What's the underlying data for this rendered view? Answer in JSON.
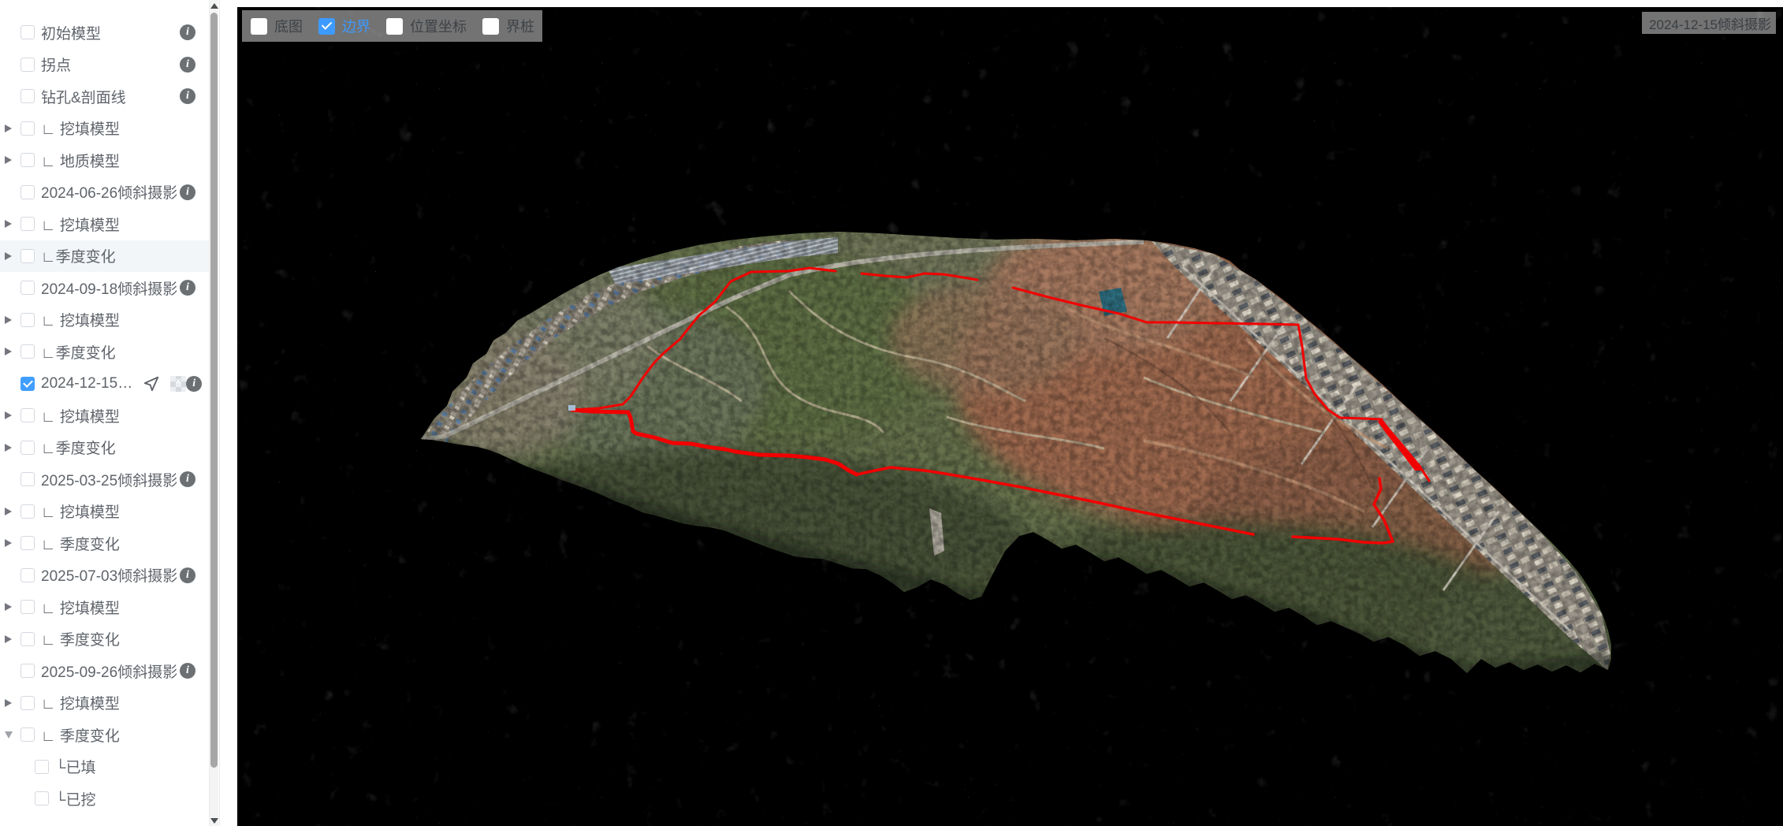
{
  "sidebar": {
    "items": [
      {
        "label": "初始模型",
        "arrow": "none",
        "checked": false,
        "info": true
      },
      {
        "label": "拐点",
        "arrow": "none",
        "checked": false,
        "info": true
      },
      {
        "label": "钻孔&剖面线",
        "arrow": "none",
        "checked": false,
        "info": true
      },
      {
        "label": "∟ 挖填模型",
        "arrow": "collapsed",
        "checked": false,
        "info": false
      },
      {
        "label": "∟ 地质模型",
        "arrow": "collapsed",
        "checked": false,
        "info": false
      },
      {
        "label": "2024-06-26倾斜摄影",
        "arrow": "none",
        "checked": false,
        "info": true
      },
      {
        "label": "∟ 挖填模型",
        "arrow": "collapsed",
        "checked": false,
        "info": false
      },
      {
        "label": "∟季度变化",
        "arrow": "collapsed",
        "checked": false,
        "info": false,
        "highlighted": true
      },
      {
        "label": "2024-09-18倾斜摄影",
        "arrow": "none",
        "checked": false,
        "info": true
      },
      {
        "label": "∟ 挖填模型",
        "arrow": "collapsed",
        "checked": false,
        "info": false
      },
      {
        "label": "∟季度变化",
        "arrow": "collapsed",
        "checked": false,
        "info": false
      },
      {
        "label": "2024-12-15…",
        "arrow": "none",
        "checked": true,
        "info": true,
        "icons": [
          "locate",
          "texture"
        ]
      },
      {
        "label": "∟ 挖填模型",
        "arrow": "collapsed",
        "checked": false,
        "info": false
      },
      {
        "label": "∟季度变化",
        "arrow": "collapsed",
        "checked": false,
        "info": false
      },
      {
        "label": "2025-03-25倾斜摄影",
        "arrow": "none",
        "checked": false,
        "info": true
      },
      {
        "label": "∟ 挖填模型",
        "arrow": "collapsed",
        "checked": false,
        "info": false
      },
      {
        "label": "∟ 季度变化",
        "arrow": "collapsed",
        "checked": false,
        "info": false
      },
      {
        "label": "2025-07-03倾斜摄影",
        "arrow": "none",
        "checked": false,
        "info": true
      },
      {
        "label": "∟ 挖填模型",
        "arrow": "collapsed",
        "checked": false,
        "info": false
      },
      {
        "label": "∟ 季度变化",
        "arrow": "collapsed",
        "checked": false,
        "info": false
      },
      {
        "label": "2025-09-26倾斜摄影",
        "arrow": "none",
        "checked": false,
        "info": true
      },
      {
        "label": "∟ 挖填模型",
        "arrow": "collapsed",
        "checked": false,
        "info": false
      },
      {
        "label": "∟ 季度变化",
        "arrow": "expanded",
        "checked": false,
        "info": false
      },
      {
        "label": "└已填",
        "arrow": "none",
        "checked": false,
        "info": false,
        "child": true
      },
      {
        "label": "└已挖",
        "arrow": "none",
        "checked": false,
        "info": false,
        "child": true
      }
    ]
  },
  "viewport": {
    "toolbar": {
      "options": [
        {
          "label": "底图",
          "checked": false
        },
        {
          "label": "边界",
          "checked": true
        },
        {
          "label": "位置坐标",
          "checked": false
        },
        {
          "label": "界桩",
          "checked": false
        }
      ]
    },
    "model_badge": "2024-12-15倾斜摄影"
  },
  "colors": {
    "accent": "#409eff",
    "boundary_line": "#f20000",
    "canvas_background": "#000000",
    "overlay_background": "rgba(255,255,255,0.45)"
  }
}
